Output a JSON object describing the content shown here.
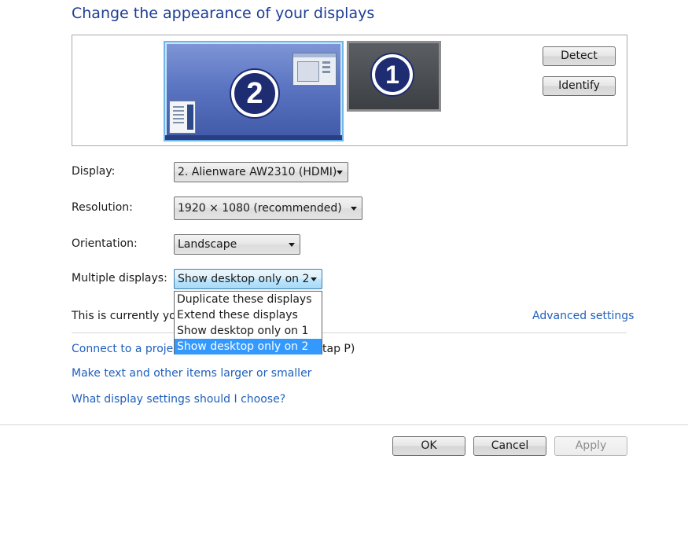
{
  "page": {
    "title": "Change the appearance of your displays"
  },
  "preview": {
    "monitors": [
      {
        "number": "2",
        "selected": true
      },
      {
        "number": "1",
        "selected": false
      }
    ],
    "detect_label": "Detect",
    "identify_label": "Identify"
  },
  "form": {
    "display_label": "Display:",
    "display_value": "2. Alienware AW2310 (HDMI)",
    "resolution_label": "Resolution:",
    "resolution_value": "1920 × 1080 (recommended)",
    "orientation_label": "Orientation:",
    "orientation_value": "Landscape",
    "multiple_label": "Multiple displays:",
    "multiple_value": "Show desktop only on 2",
    "multiple_options": [
      "Duplicate these displays",
      "Extend these displays",
      "Show desktop only on 1",
      "Show desktop only on 2"
    ],
    "multiple_selected_index": 3
  },
  "status_text": "This is currently you",
  "advanced_link": "Advanced settings",
  "links": {
    "projector_prefix": "Connect to a projec",
    "projector_suffix": "tap P)",
    "text_size": "Make text and other items larger or smaller",
    "help": "What display settings should I choose?"
  },
  "footer": {
    "ok": "OK",
    "cancel": "Cancel",
    "apply": "Apply",
    "apply_enabled": false
  },
  "colors": {
    "title": "#1e3e96",
    "link": "#1e5fbd",
    "selection": "#3399ff",
    "monitor_selected": "#5b75c2",
    "monitor_inactive": "#4a4e52"
  }
}
